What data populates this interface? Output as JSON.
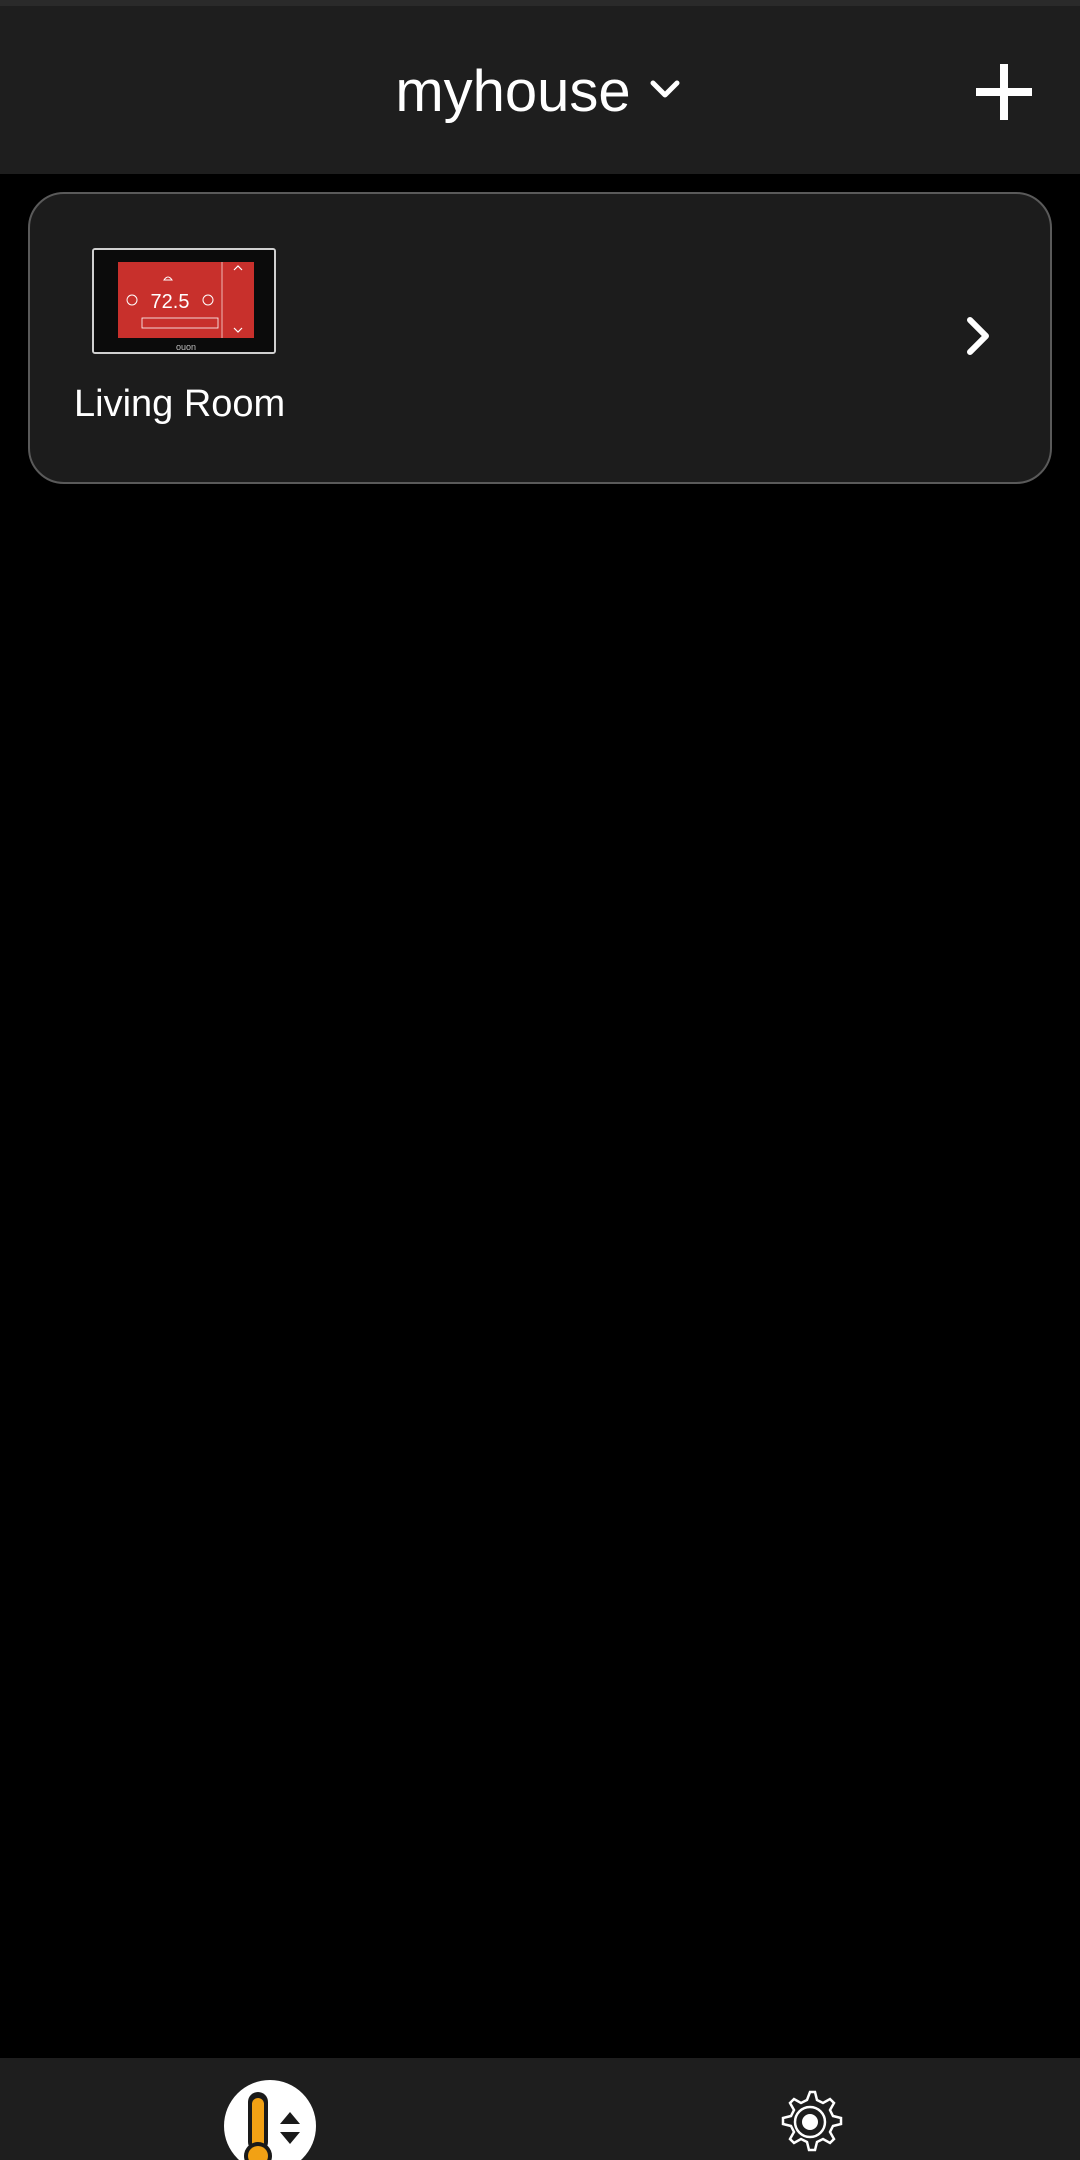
{
  "header": {
    "home_name": "myhouse",
    "dropdown_icon": "chevron-down-icon",
    "add_icon": "plus-icon"
  },
  "rooms": [
    {
      "label": "Living Room",
      "thermostat_reading": "72.5",
      "brand": "ouon",
      "thumbnail_icon": "thermostat-image",
      "arrow_icon": "chevron-right-icon"
    }
  ],
  "tabbar": {
    "tabs": [
      {
        "name": "thermostats",
        "icon": "thermometer-icon",
        "active": true
      },
      {
        "name": "settings",
        "icon": "gear-icon",
        "active": false
      }
    ]
  },
  "colors": {
    "background": "#000000",
    "surface": "#1e1e1e",
    "card_border": "#5a5a5a",
    "thermostat_screen": "#c8302c",
    "accent_orange": "#f2a114"
  }
}
